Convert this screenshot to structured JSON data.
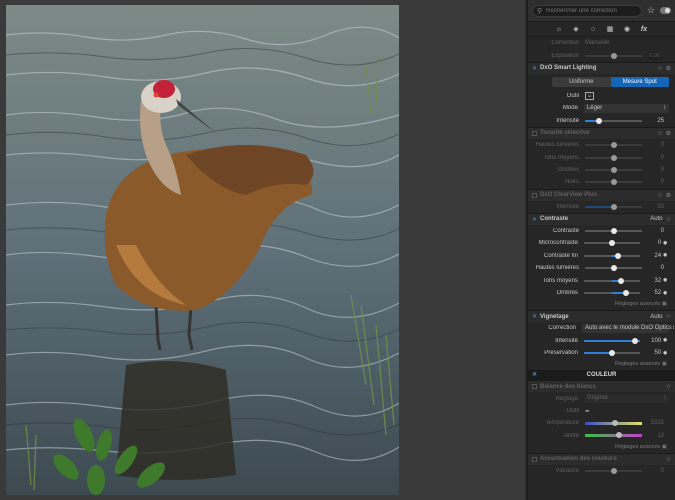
{
  "search": {
    "placeholder": "Rechercher une correction"
  },
  "tabs": [
    "sun-icon",
    "palette-icon",
    "aperture-icon",
    "layers-icon",
    "globe-icon",
    "fx-icon"
  ],
  "tab_fx_label": "fx",
  "correction_top": {
    "label": "Correction",
    "value": "Manuelle"
  },
  "exposition": {
    "label": "Exposition",
    "value": "0,00",
    "level": 0.5
  },
  "smart_lighting": {
    "title": "DxO Smart Lighting",
    "seg_uniforme": "Uniforme",
    "seg_mesure": "Mesure Spot",
    "outil_label": "Outil",
    "mode_label": "Mode",
    "mode_value": "Léger",
    "intensite_label": "Intensité",
    "intensite_value": "25",
    "intensite_level": 0.25
  },
  "tonalite": {
    "title": "Tonalité sélective",
    "rows": [
      {
        "label": "Hautes lumières",
        "value": "0",
        "level": 0.5
      },
      {
        "label": "Tons moyens",
        "value": "0",
        "level": 0.5
      },
      {
        "label": "Ombres",
        "value": "0",
        "level": 0.5
      },
      {
        "label": "Noirs",
        "value": "0",
        "level": 0.5
      }
    ]
  },
  "clearview": {
    "title": "DxO ClearView Plus",
    "label": "Intensité",
    "value": "50",
    "level": 0.5
  },
  "contraste": {
    "title": "Contraste",
    "auto": "Auto",
    "rows": [
      {
        "label": "Contraste",
        "value": "0",
        "level": 0.5
      },
      {
        "label": "Microcontraste",
        "value": "0",
        "level": 0.5
      },
      {
        "label": "Contraste fin",
        "value": "24",
        "level": 0.62
      },
      {
        "label": "Hautes lumières",
        "value": "0",
        "level": 0.5
      },
      {
        "label": "Tons moyens",
        "value": "32",
        "level": 0.66
      },
      {
        "label": "Ombres",
        "value": "52",
        "level": 0.76
      }
    ],
    "advanced": "Réglages avancés"
  },
  "vignetage": {
    "title": "Vignetage",
    "auto": "Auto",
    "correction_label": "Correction",
    "correction_value": "Auto avec le module DxO Optics",
    "intensite_label": "Intensité",
    "intensite_value": "100",
    "intensite_level": 1.0,
    "preservation_label": "Préservation",
    "preservation_value": "50",
    "preservation_level": 0.5,
    "advanced": "Réglages avancés"
  },
  "couleur": {
    "title": "COULEUR"
  },
  "balance": {
    "title": "Balance des blancs",
    "reglage_label": "Réglage",
    "reglage_value": "Original",
    "outil_label": "Outil",
    "temperature_label": "Température",
    "temperature_value": "5315",
    "temperature_level": 0.48,
    "teinte_label": "Teinte",
    "teinte_value": "12",
    "teinte_level": 0.55,
    "advanced": "Réglages avancés"
  },
  "accentuation": {
    "title": "Accentuation des couleurs",
    "vibrance_label": "Vibrance",
    "vibrance_value": "0",
    "vibrance_level": 0.5
  },
  "colors": {
    "accent": "#1466b8",
    "panel": "#262626",
    "canvas": "#3a3a3a"
  }
}
